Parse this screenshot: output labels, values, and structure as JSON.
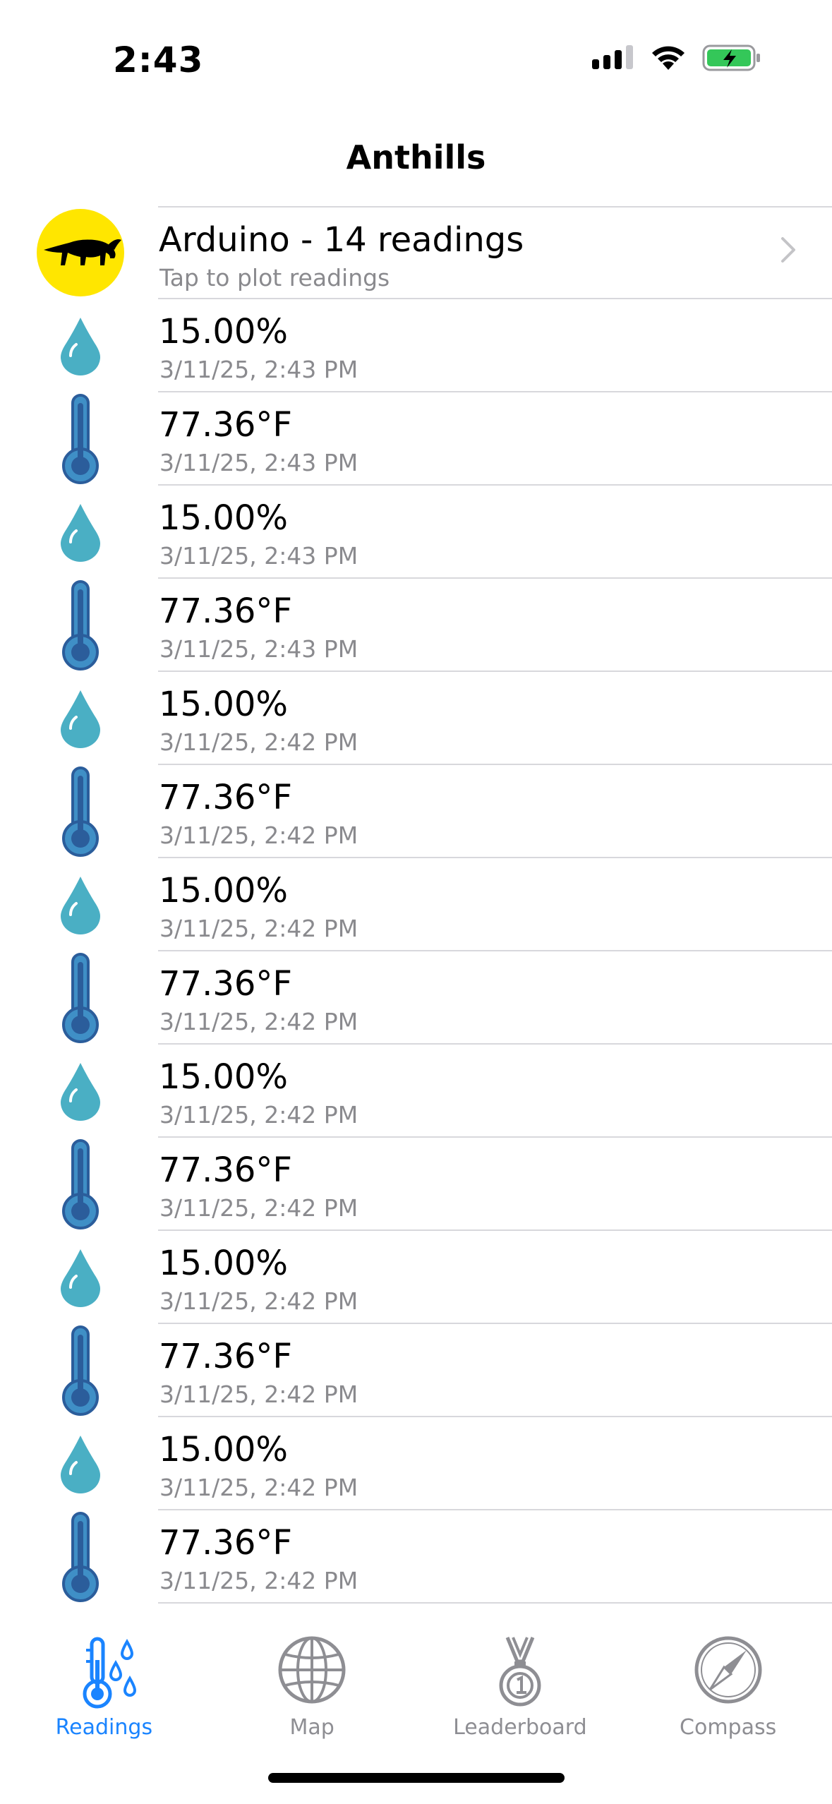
{
  "status_bar": {
    "time": "2:43"
  },
  "nav": {
    "title": "Anthills"
  },
  "header_row": {
    "title": "Arduino - 14 readings",
    "subtitle": "Tap to plot readings",
    "avatar_icon": "anteater-icon",
    "avatar_color": "#ffe600"
  },
  "readings": [
    {
      "type": "humidity",
      "value": "15.00%",
      "timestamp": "3/11/25, 2:43 PM"
    },
    {
      "type": "temperature",
      "value": "77.36°F",
      "timestamp": "3/11/25, 2:43 PM"
    },
    {
      "type": "humidity",
      "value": "15.00%",
      "timestamp": "3/11/25, 2:43 PM"
    },
    {
      "type": "temperature",
      "value": "77.36°F",
      "timestamp": "3/11/25, 2:43 PM"
    },
    {
      "type": "humidity",
      "value": "15.00%",
      "timestamp": "3/11/25, 2:42 PM"
    },
    {
      "type": "temperature",
      "value": "77.36°F",
      "timestamp": "3/11/25, 2:42 PM"
    },
    {
      "type": "humidity",
      "value": "15.00%",
      "timestamp": "3/11/25, 2:42 PM"
    },
    {
      "type": "temperature",
      "value": "77.36°F",
      "timestamp": "3/11/25, 2:42 PM"
    },
    {
      "type": "humidity",
      "value": "15.00%",
      "timestamp": "3/11/25, 2:42 PM"
    },
    {
      "type": "temperature",
      "value": "77.36°F",
      "timestamp": "3/11/25, 2:42 PM"
    },
    {
      "type": "humidity",
      "value": "15.00%",
      "timestamp": "3/11/25, 2:42 PM"
    },
    {
      "type": "temperature",
      "value": "77.36°F",
      "timestamp": "3/11/25, 2:42 PM"
    },
    {
      "type": "humidity",
      "value": "15.00%",
      "timestamp": "3/11/25, 2:42 PM"
    },
    {
      "type": "temperature",
      "value": "77.36°F",
      "timestamp": "3/11/25, 2:42 PM"
    }
  ],
  "tabs": [
    {
      "label": "Readings",
      "icon": "thermometer-drops-icon",
      "active": true
    },
    {
      "label": "Map",
      "icon": "globe-icon",
      "active": false
    },
    {
      "label": "Leaderboard",
      "icon": "medal-icon",
      "active": false
    },
    {
      "label": "Compass",
      "icon": "compass-icon",
      "active": false
    }
  ],
  "colors": {
    "accent": "#1a84ff",
    "drop": "#4aafc4",
    "thermometer": "#3f8fc6",
    "thermometer_outline": "#2b5d9b",
    "inactive_tab": "#8e8e93",
    "battery": "#34c759"
  }
}
